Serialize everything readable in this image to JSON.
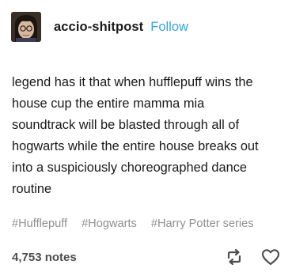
{
  "post": {
    "author": {
      "username": "accio-shitpost",
      "follow_label": "Follow",
      "avatar_icon": "avatar-portrait"
    },
    "body": {
      "lines": [
        "legend has it that when hufflepuff wins the",
        "house cup the entire mamma mia",
        "soundtrack will be blasted through all of",
        "hogwarts while the entire house breaks out",
        "into a suspiciously choreographed dance",
        "routine"
      ]
    },
    "tags": [
      "#Hufflepuff",
      "#Hogwarts",
      "#Harry Potter series"
    ],
    "footer": {
      "notes": "4,753 notes",
      "reblog_icon": "reblog-icon",
      "like_icon": "heart-icon"
    },
    "colors": {
      "follow": "#36a3e8",
      "tag": "#8f8f8f",
      "notes": "#4d4d4d",
      "icon": "#4d4d4d"
    }
  }
}
